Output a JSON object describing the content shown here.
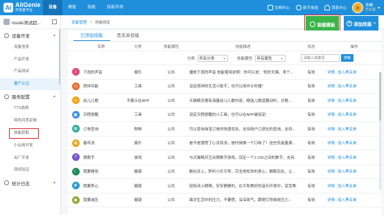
{
  "app": {
    "logo_mark": "Ai",
    "name": "AliGenie",
    "subtitle": "开发者平台"
  },
  "nav": [
    "设备",
    "模板",
    "技能",
    "技能市场"
  ],
  "top_links": [
    "文档中心",
    "新手体验",
    "消息中心"
  ],
  "user": {
    "avatar_text": "冰",
    "name": "赤峰",
    "status": "已认证"
  },
  "sidebar": {
    "app_name": "inside测试超...",
    "groups": [
      {
        "label": "设备开发",
        "items": [
          "设备信息",
          "产品开发",
          "产品测试",
          "量产认证"
        ]
      },
      {
        "label": "服务配置",
        "items": [
          "TTS选择",
          "特色问答定制",
          "技能获取",
          "小云用开发",
          "出厂开发",
          "测试验证"
        ]
      },
      {
        "label": "统计日志",
        "items": []
      }
    ],
    "active_item": "量产认证",
    "highlighted_item": "技能获取"
  },
  "breadcrumb": {
    "root": "设备管理",
    "current": "技能绑定"
  },
  "buttons": {
    "load_template": "装载模板",
    "add_skill": "添加技能"
  },
  "tabs": [
    "已添加技能",
    "黑名单技能"
  ],
  "table": {
    "headers": [
      "名称",
      "分类",
      "技能属性",
      "技能描述",
      "状态",
      "操作"
    ],
    "filters": {
      "category_label": "分类:",
      "category_value": "所有分类",
      "attr_label": "技能属性:",
      "attr_value": "所有属性",
      "search_placeholder": "请输入关键词",
      "search_button": "搜索"
    },
    "ops": [
      "详情",
      "加入黑名单"
    ],
    "rows": [
      {
        "name": "下雨的声音",
        "category": "娱乐",
        "attr": "公共",
        "desc": "播放下雨的声音 技能使用说明：你可以说：'你好天猫，来个...",
        "status": "有效",
        "color": "#d94e7a",
        "glyph": "♪"
      },
      {
        "name": "闹钟功能",
        "category": "工具",
        "attr": "公共",
        "desc": "设定闹钟的生活小助手，也可以用作计时器！",
        "status": "有效",
        "color": "#e36b2d",
        "glyph": "◷"
      },
      {
        "name": "幼儿儿歌",
        "category": "不展示在APP",
        "attr": "公共",
        "desc": "天猫精灵拥有海量幼儿儿歌内容，精选儿歌逗趣动听，识歌...",
        "status": "有效",
        "color": "#f2a71f",
        "glyph": "♫"
      },
      {
        "name": "日程提醒",
        "category": "工具",
        "attr": "公共",
        "desc": "设定日程提醒的小工具，也可以在APP端设定!",
        "status": "有效",
        "color": "#3b8fe0",
        "glyph": "▣"
      },
      {
        "name": "订单查询",
        "category": "购物",
        "attr": "公共",
        "desc": "可以查询淘宝订单的快递状态，支持用户口语化的查询，支持...",
        "status": "有效",
        "color": "#2eaa9a",
        "glyph": "▤"
      },
      {
        "name": "春鸡汤",
        "category": "娱乐",
        "attr": "公共",
        "desc": "是不是饿慌了心灵鸡汤，是时候换一个口味了！这些负能量满...",
        "status": "有效",
        "color": "#e8a92a",
        "glyph": "✿"
      },
      {
        "name": "猜数字",
        "category": "游戏",
        "attr": "公共",
        "desc": "与天猫精灵互动猜数字游戏，设定一个1-100之间的数字，支持...",
        "status": "有效",
        "color": "#7a55c9",
        "glyph": "?"
      },
      {
        "name": "我要睡觉",
        "category": "健康",
        "attr": "公共",
        "desc": "躺在床上，聆听小乐引导，完全放松你的身心，酣眠安此，让...",
        "status": "有效",
        "color": "#1f8a5b",
        "glyph": "☾"
      },
      {
        "name": "我要养心",
        "category": "健康",
        "attr": "公共",
        "desc": "轻松闭上眼睛，安安静静的，在平和美好的音乐环境中，享受美...",
        "status": "有效",
        "color": "#2f9bd0",
        "glyph": "❀"
      },
      {
        "name": "我要减压",
        "category": "健康",
        "attr": "公共",
        "desc": "面对生活中的压力，不要慌，深深吸气，跟随引导释放压力...",
        "status": "有效",
        "color": "#9aa63a",
        "glyph": "◉"
      }
    ]
  }
}
